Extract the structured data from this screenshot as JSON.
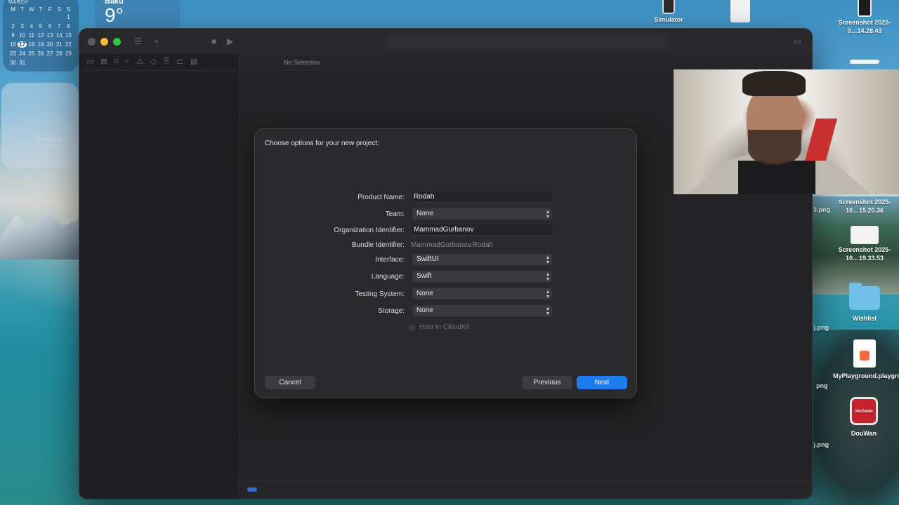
{
  "desktop": {
    "calendar": {
      "month": "MARCH",
      "weekdays": [
        "M",
        "T",
        "W",
        "T",
        "F",
        "S",
        "S"
      ],
      "days": [
        "",
        "",
        "",
        "",
        "",
        "",
        "1",
        "2",
        "3",
        "4",
        "5",
        "6",
        "7",
        "8",
        "9",
        "10",
        "11",
        "12",
        "13",
        "14",
        "15",
        "16",
        "17",
        "18",
        "19",
        "20",
        "21",
        "22",
        "23",
        "24",
        "25",
        "26",
        "27",
        "28",
        "29",
        "30",
        "31",
        "",
        "",
        "",
        "",
        ""
      ],
      "today": "17"
    },
    "weather": {
      "city": "Baku",
      "temp": "9°"
    },
    "photos_widget_text": "Photos will ap… finish…",
    "icons": {
      "simulator": "Simulator",
      "screenshot_1": "Screenshot 2025-0…14.28.43",
      "screenshot_2": "Screenshot 2025-10…15.20.36",
      "screenshot_3": "Screenshot 2025-10…19.33.53",
      "wishlist": "Wishlist",
      "playground": "MyPlayground.playground",
      "douwan": "DouWan",
      "douwan_badge": "XinDawn"
    },
    "partial_labels": {
      "png_1": "3.png",
      "png_2": ").png",
      "png_3": "png",
      "png_4": ").png"
    }
  },
  "xcode": {
    "editor_header": "No Selection",
    "accent_color": "#1f7cf0"
  },
  "dialog": {
    "title": "Choose options for your new project:",
    "fields": {
      "product_name": {
        "label": "Product Name:",
        "value": "Rodah"
      },
      "team": {
        "label": "Team:",
        "value": "None"
      },
      "organization_identifier": {
        "label": "Organization Identifier:",
        "value": "MammadGurbanov"
      },
      "bundle_identifier": {
        "label": "Bundle Identifier:",
        "value": "MammadGurbanov.Rodah"
      },
      "interface": {
        "label": "Interface:",
        "value": "SwiftUI"
      },
      "language": {
        "label": "Language:",
        "value": "Swift"
      },
      "testing_system": {
        "label": "Testing System:",
        "value": "None"
      },
      "storage": {
        "label": "Storage:",
        "value": "None"
      }
    },
    "host_in_cloudkit": {
      "label": "Host in CloudKit",
      "checked": false,
      "enabled": false
    },
    "buttons": {
      "cancel": "Cancel",
      "previous": "Previous",
      "next": "Next"
    }
  }
}
